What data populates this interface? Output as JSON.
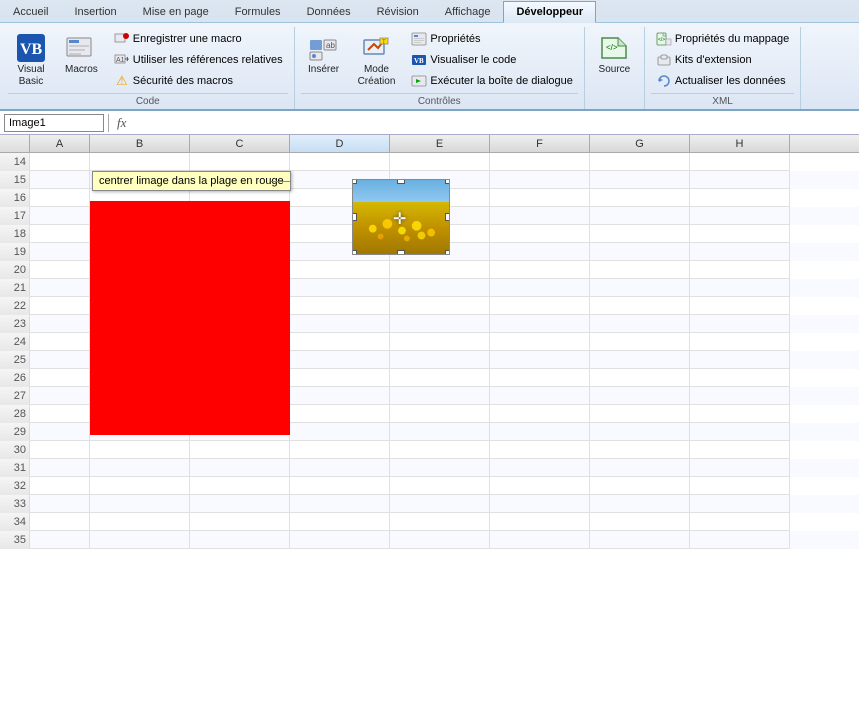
{
  "ribbon": {
    "tabs": [
      {
        "label": "Accueil",
        "active": false
      },
      {
        "label": "Insertion",
        "active": false
      },
      {
        "label": "Mise en page",
        "active": false
      },
      {
        "label": "Formules",
        "active": false
      },
      {
        "label": "Données",
        "active": false
      },
      {
        "label": "Révision",
        "active": false
      },
      {
        "label": "Affichage",
        "active": false
      },
      {
        "label": "Développeur",
        "active": true
      }
    ],
    "groups": {
      "code": {
        "label": "Code",
        "visual_basic": "Visual\nBasic",
        "macros": "Macros",
        "enregistrer_macro": "Enregistrer une macro",
        "references_relatives": "Utiliser les références relatives",
        "securite_macros": "Sécurité des macros"
      },
      "controles": {
        "label": "Contrôles",
        "inserer": "Insérer",
        "mode_creation": "Mode\nCréation",
        "proprietes": "Propriétés",
        "visualiser_code": "Visualiser le code",
        "executer_boite": "Exécuter la boîte de dialogue"
      },
      "xml": {
        "label": "XML",
        "source": "Source",
        "proprietes_mappages": "Propriétés du mappage",
        "kits_extension": "Kits d'extension",
        "actualiser_donnees": "Actualiser les données"
      }
    }
  },
  "formula_bar": {
    "name_box": "Image1",
    "fx": "fx"
  },
  "spreadsheet": {
    "cols": [
      "",
      "A",
      "B",
      "C",
      "D",
      "E",
      "F",
      "G",
      "H"
    ],
    "rows": [
      14,
      15,
      16,
      17,
      18,
      19,
      20,
      21,
      22,
      23,
      24,
      25,
      26,
      27,
      28,
      29,
      30,
      31,
      32,
      33,
      34,
      35
    ],
    "comment_text": "centrer limage dans la plage en rouge"
  }
}
